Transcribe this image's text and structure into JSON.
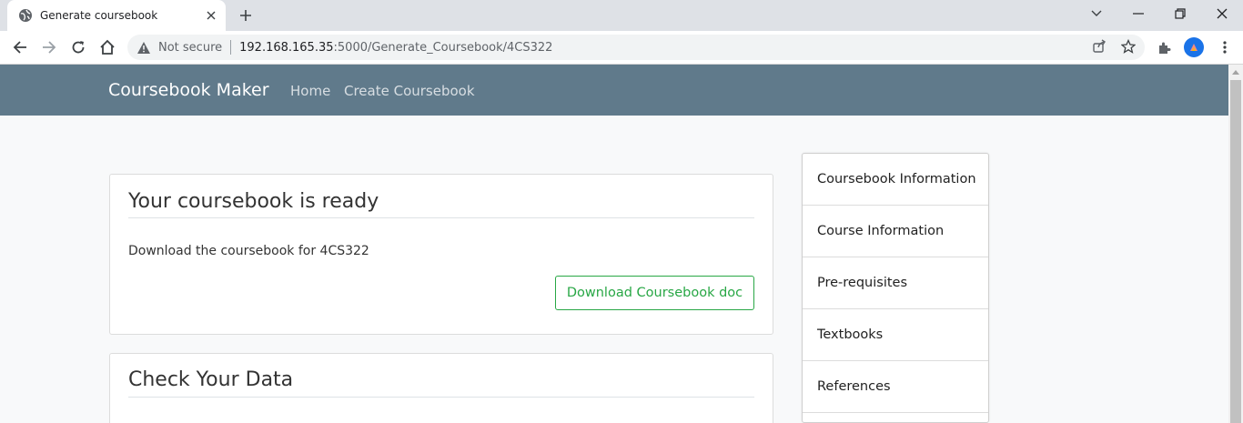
{
  "browser": {
    "tab_title": "Generate coursebook",
    "security_label": "Not secure",
    "url_host": "192.168.165.35",
    "url_rest": ":5000/Generate_Coursebook/4CS322"
  },
  "navbar": {
    "brand": "Coursebook Maker",
    "links": [
      "Home",
      "Create Coursebook"
    ],
    "background": "#607a8b"
  },
  "ready_card": {
    "title": "Your coursebook is ready",
    "text": "Download the coursebook for 4CS322",
    "button": "Download Coursebook doc",
    "accent": "#28a745"
  },
  "check_card": {
    "title": "Check Your Data"
  },
  "sidebar": {
    "items": [
      "Coursebook Information",
      "Course Information",
      "Pre-requisites",
      "Textbooks",
      "References"
    ]
  }
}
